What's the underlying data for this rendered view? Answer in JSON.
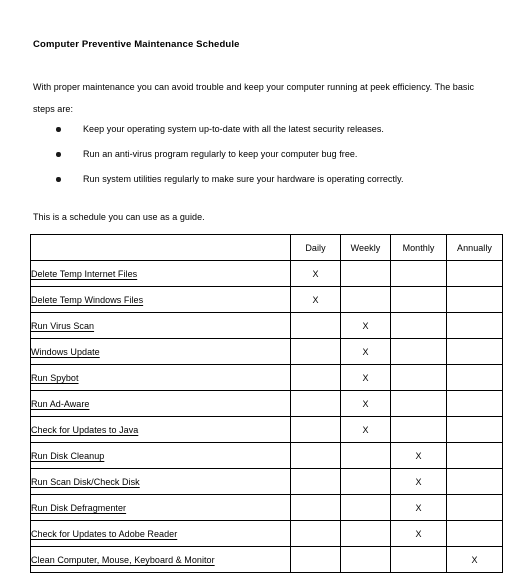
{
  "document": {
    "title": "Computer Preventive Maintenance Schedule",
    "intro_paragraph": "With proper maintenance you can avoid trouble and keep your computer running at peek efficiency. The basic steps are:",
    "bullets": [
      "Keep your operating system up-to-date with all the latest security releases.",
      "Run an anti-virus program regularly to keep your computer bug free.",
      "Run system utilities regularly to make sure your hardware is operating correctly."
    ],
    "guide_line": "This is a schedule you can use as a guide."
  },
  "table": {
    "task_column_header": "",
    "frequency_headers": [
      "Daily",
      "Weekly",
      "Monthly",
      "Annually"
    ],
    "mark_symbol": "X",
    "rows": [
      {
        "task": "Delete Temp Internet Files",
        "daily": "X",
        "weekly": "",
        "monthly": "",
        "annually": ""
      },
      {
        "task": "Delete Temp Windows Files",
        "daily": "X",
        "weekly": "",
        "monthly": "",
        "annually": ""
      },
      {
        "task": "Run Virus Scan",
        "daily": "",
        "weekly": "X",
        "monthly": "",
        "annually": ""
      },
      {
        "task": "Windows Update",
        "daily": "",
        "weekly": "X",
        "monthly": "",
        "annually": ""
      },
      {
        "task": "Run Spybot",
        "daily": "",
        "weekly": "X",
        "monthly": "",
        "annually": ""
      },
      {
        "task": "Run Ad-Aware",
        "daily": "",
        "weekly": "X",
        "monthly": "",
        "annually": ""
      },
      {
        "task": "Check for Updates to Java",
        "daily": "",
        "weekly": "X",
        "monthly": "",
        "annually": ""
      },
      {
        "task": "Run Disk Cleanup",
        "daily": "",
        "weekly": "",
        "monthly": "X",
        "annually": ""
      },
      {
        "task": "Run Scan Disk/Check Disk",
        "daily": "",
        "weekly": "",
        "monthly": "X",
        "annually": ""
      },
      {
        "task": "Run Disk Defragmenter",
        "daily": "",
        "weekly": "",
        "monthly": "X",
        "annually": ""
      },
      {
        "task": "Check for Updates to Adobe Reader",
        "daily": "",
        "weekly": "",
        "monthly": "X",
        "annually": ""
      },
      {
        "task": "Clean Computer, Mouse, Keyboard & Monitor",
        "daily": "",
        "weekly": "",
        "monthly": "",
        "annually": "X"
      }
    ]
  },
  "colors": {
    "page_background": "#ffffff",
    "text": "#000000",
    "table_border": "#000000"
  }
}
